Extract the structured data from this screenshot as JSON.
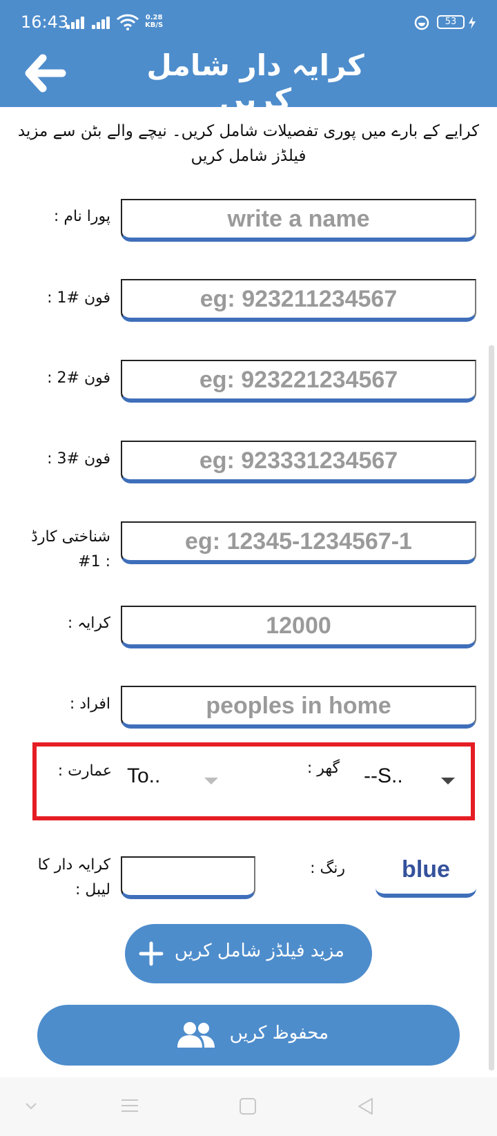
{
  "status_bar": {
    "time": "16:43",
    "net_speed_value": "0.28",
    "net_speed_unit": "KB/S",
    "battery": "53"
  },
  "header": {
    "title": "کرایہ دار شامل کریں"
  },
  "description": "کرایے کے بارے میں پوری تفصیلات شامل کریں۔ نیچے والے بٹن سے مزید فیلڈز شامل کریں",
  "form": {
    "full_name": {
      "label": "پورا نام :",
      "placeholder": "write a name",
      "value": ""
    },
    "phone1": {
      "label": "فون #1 :",
      "placeholder": "eg: 923211234567",
      "value": ""
    },
    "phone2": {
      "label": "فون #2 :",
      "placeholder": "eg: 923221234567",
      "value": ""
    },
    "phone3": {
      "label": "فون #3 :",
      "placeholder": "eg: 923331234567",
      "value": ""
    },
    "cnic": {
      "label_line1": "شناختی کارڈ",
      "label_line2": "#1 :",
      "placeholder": "eg: 12345-1234567-1",
      "value": ""
    },
    "rent": {
      "label": "کرایہ :",
      "placeholder": "",
      "value": "12000"
    },
    "members": {
      "label": "افراد :",
      "placeholder": "peoples in home",
      "value": ""
    },
    "building": {
      "label": "عمارت :",
      "selected": "To.."
    },
    "house": {
      "label": "گھر :",
      "selected": "--S.."
    },
    "tenant_label": {
      "label_line1": "کرایہ دار کا",
      "label_line2": "لیبل :",
      "value": ""
    },
    "color": {
      "label": "رنگ :",
      "value": "blue"
    }
  },
  "buttons": {
    "add_fields": "مزید فیلڈز شامل کریں",
    "save": "محفوظ کریں"
  },
  "colors": {
    "primary": "#4e8dcc",
    "underline": "#3f6fba",
    "highlight": "#e51e24",
    "color_value_text": "#34519b"
  }
}
